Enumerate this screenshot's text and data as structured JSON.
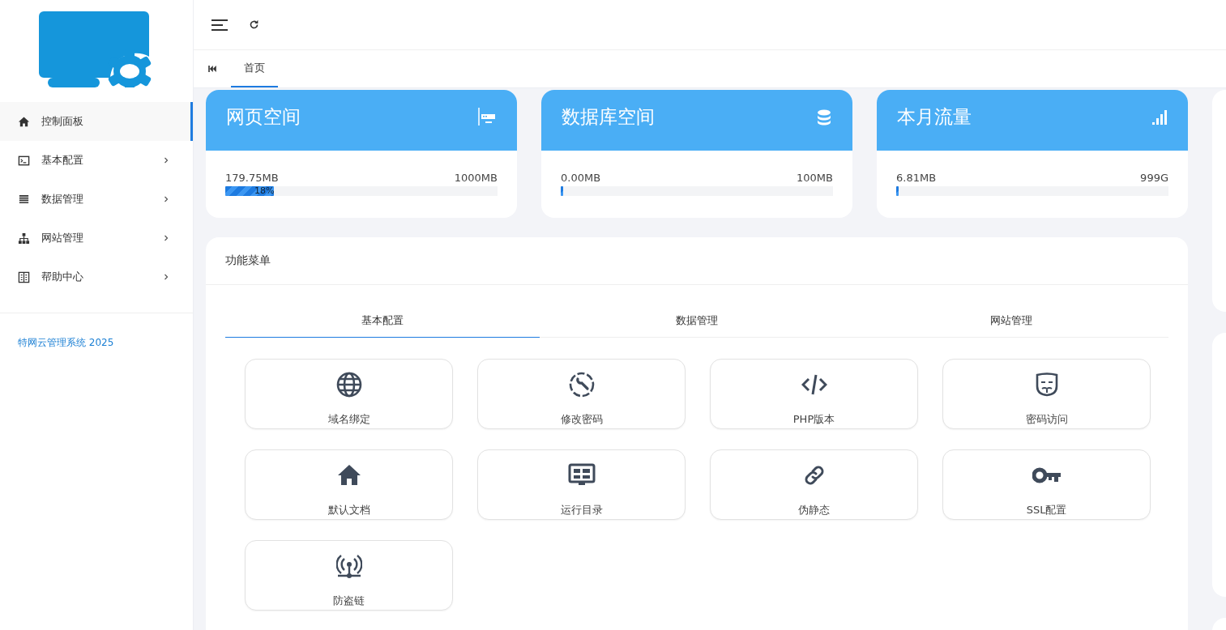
{
  "sidebar": {
    "items": [
      {
        "label": "控制面板",
        "kind": "home",
        "selected": true,
        "has_submenu": false
      },
      {
        "label": "基本配置",
        "kind": "terminal",
        "selected": false,
        "has_submenu": true
      },
      {
        "label": "数据管理",
        "kind": "list",
        "selected": false,
        "has_submenu": true
      },
      {
        "label": "网站管理",
        "kind": "sitemap",
        "selected": false,
        "has_submenu": true
      },
      {
        "label": "帮助中心",
        "kind": "book",
        "selected": false,
        "has_submenu": true
      }
    ],
    "footer": "特网云管理系统 2025"
  },
  "page_tabs": [
    {
      "label": "首页",
      "selected": true
    }
  ],
  "stat_cards": [
    {
      "title": "网页空间",
      "kind": "server",
      "used": "179.75MB",
      "total": "1000MB",
      "level": 0.18,
      "percent": "18%"
    },
    {
      "title": "数据库空间",
      "kind": "database",
      "used": "0.00MB",
      "total": "100MB",
      "level": 0
    },
    {
      "title": "本月流量",
      "kind": "signal",
      "used": "6.81MB",
      "total": "999G",
      "level": 0.01
    }
  ],
  "function_menu": {
    "title": "功能菜单",
    "tabs": [
      {
        "label": "基本配置",
        "selected": true
      },
      {
        "label": "数据管理",
        "selected": false
      },
      {
        "label": "网站管理",
        "selected": false
      }
    ],
    "tiles": [
      {
        "label": "域名绑定",
        "kind": "globe"
      },
      {
        "label": "修改密码",
        "kind": "wrench"
      },
      {
        "label": "PHP版本",
        "kind": "code"
      },
      {
        "label": "密码访问",
        "kind": "mask"
      },
      {
        "label": "默认文档",
        "kind": "home"
      },
      {
        "label": "运行目录",
        "kind": "monitor"
      },
      {
        "label": "伪静态",
        "kind": "link"
      },
      {
        "label": "SSL配置",
        "kind": "key"
      },
      {
        "label": "防盗链",
        "kind": "antenna"
      }
    ]
  }
}
